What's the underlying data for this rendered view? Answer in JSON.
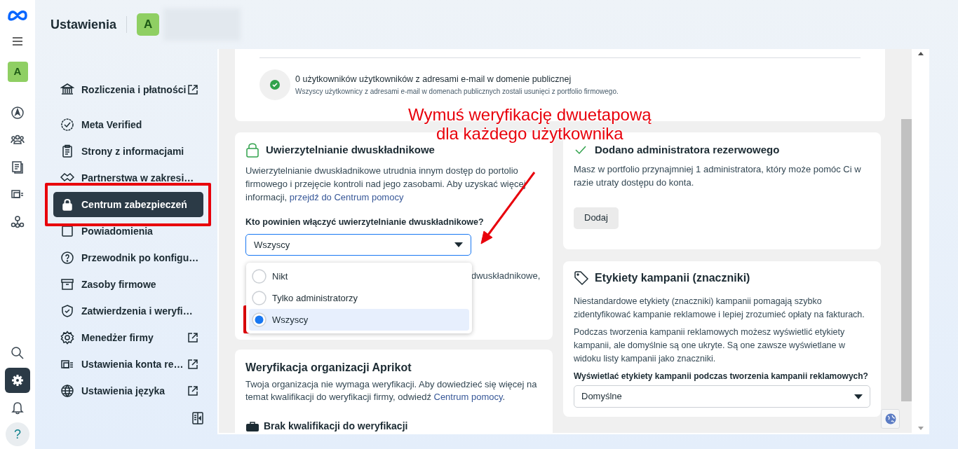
{
  "header": {
    "title": "Ustawienia",
    "account_avatar": "A"
  },
  "rail": {
    "avatar": "A",
    "top_items": [
      {
        "kind": "compass",
        "selected": false
      },
      {
        "kind": "people",
        "selected": false
      },
      {
        "kind": "pages",
        "selected": false
      },
      {
        "kind": "media",
        "selected": false
      },
      {
        "kind": "network",
        "selected": false
      }
    ],
    "bottom_items": [
      {
        "kind": "search",
        "selected": false
      },
      {
        "kind": "settings",
        "selected": true
      },
      {
        "kind": "bell",
        "selected": false
      },
      {
        "kind": "help",
        "selected": false
      }
    ],
    "help_label": "?"
  },
  "sidebar": {
    "items": [
      {
        "label": "Rozliczenia i płatności",
        "external": true,
        "selected": false
      },
      {
        "label": "Meta Verified",
        "external": false,
        "selected": false
      },
      {
        "label": "Strony z informacjami",
        "external": false,
        "selected": false
      },
      {
        "label": "Partnerstwa w zakresi…",
        "external": false,
        "selected": false
      },
      {
        "label": "Centrum zabezpieczeń",
        "external": false,
        "selected": true
      },
      {
        "label": "Powiadomienia",
        "external": false,
        "selected": false
      },
      {
        "label": "Przewodnik po konfigu…",
        "external": false,
        "selected": false
      },
      {
        "label": "Zasoby firmowe",
        "external": false,
        "selected": false
      },
      {
        "label": "Zatwierdzenia i weryfi…",
        "external": false,
        "selected": false
      },
      {
        "label": "Menedżer firmy",
        "external": true,
        "selected": false
      },
      {
        "label": "Ustawienia konta re…",
        "external": true,
        "selected": false
      },
      {
        "label": "Ustawienia języka",
        "external": true,
        "selected": false
      }
    ]
  },
  "public_email_notice": {
    "title": "0 użytkowników użytkowników z adresami e-mail w domenie publicznej",
    "subtitle": "Wszyscy użytkownicy z adresami e-mail w domenach publicznych zostali usunięci z portfolio firmowego."
  },
  "two_factor": {
    "title": "Uwierzytelnianie dwuskładnikowe",
    "description": "Uwierzytelnianie dwuskładnikowe utrudnia innym dostęp do portolio firmowego i przejęcie kontroli nad jego zasobami. Aby uzyskać więcej informacji, ",
    "link": "przejdź do Centrum pomocy",
    "question": "Kto powinien włączyć uwierzytelnianie dwuskładnikowe?",
    "select_value": "Wszyscy",
    "options": [
      {
        "label": "Nikt",
        "selected": false
      },
      {
        "label": "Tylko administratorzy",
        "selected": false
      },
      {
        "label": "Wszyscy",
        "selected": true
      }
    ],
    "text_behind_menu": "dwuskładnikowe,"
  },
  "backup_admin": {
    "title": "Dodano administratora rezerwowego",
    "description": "Masz w portfolio przynajmniej 1 administratora, który może pomóc Ci w razie utraty dostępu do konta.",
    "button": "Dodaj"
  },
  "campaign_labels": {
    "title": "Etykiety kampanii (znaczniki)",
    "paragraphs": [
      "Niestandardowe etykiety (znaczniki) kampanii pomagają szybko zidentyfikować kampanie reklamowe i lepiej zrozumieć opłaty na fakturach.",
      "Podczas tworzenia kampanii reklamowych możesz wyświetlić etykiety kampanii, ale domyślnie są one ukryte. Są one zawsze wyświetlane w widoku listy kampanii jako znaczniki."
    ],
    "question": "Wyświetlać etykiety kampanii podczas tworzenia kampanii reklamowych?",
    "select_value": "Domyślne"
  },
  "org_verification": {
    "title": "Weryfikacja organizacji Aprikot",
    "description": "Twoja organizacja nie wymaga weryfikacji. Aby dowiedzieć się więcej na temat kwalifikacji do weryfikacji firmy, odwiedź ",
    "link": "Centrum pomocy",
    "description_end": ".",
    "status": "Brak kwalifikacji do weryfikacji"
  },
  "annotation": {
    "lines": [
      "Wymuś weryfikację dwuetapową",
      "dla każdego użytkownika"
    ]
  }
}
